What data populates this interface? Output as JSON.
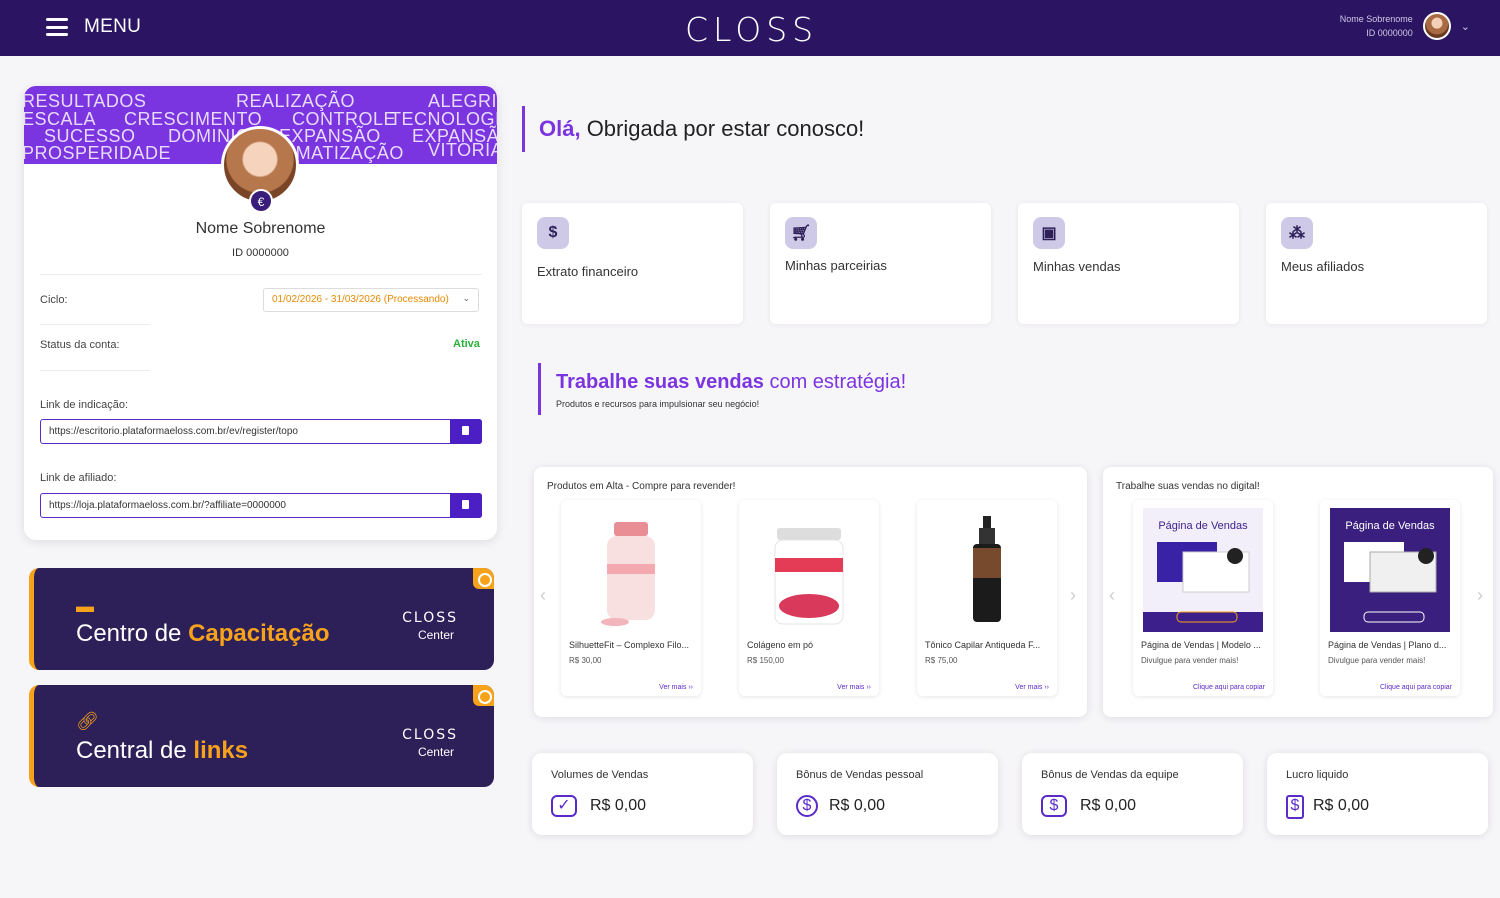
{
  "header": {
    "menu_label": "MENU",
    "logo": "CLOSS",
    "user_name": "Nome Sobrenome",
    "user_id": "ID 0000000"
  },
  "profile": {
    "banner_words": [
      "RESULTADOS",
      "REALIZAÇÃO",
      "ALEGRIA",
      "ESCALA",
      "CRESCIMENTO",
      "CONTROLE",
      "TECNOLOGIA",
      "SUCESSO",
      "DOMINIO",
      "EXPANSÃO",
      "EXPANSÃO",
      "PROSPERIDADE",
      "AUTOMATIZAÇÃO",
      "VITORIA"
    ],
    "name": "Nome Sobrenome",
    "id": "ID 0000000",
    "cycle_label": "Ciclo:",
    "cycle_value": "01/02/2026 - 31/03/2026 (Processando)",
    "status_label": "Status da conta:",
    "status_value": "Ativa",
    "ref_label": "Link de indicação:",
    "ref_link": "https://escritorio.plataformaeloss.com.br/ev/register/topo",
    "aff_label": "Link de afiliado:",
    "aff_link": "https://loja.plataformaeloss.com.br/?affiliate=0000000"
  },
  "promos": [
    {
      "title_a": "Centro de ",
      "title_b": "Capacitação",
      "brand": "CLOSS",
      "sub": "Center"
    },
    {
      "title_a": "Central de ",
      "title_b": "links",
      "brand": "CLOSS",
      "sub": "Center"
    }
  ],
  "greeting": {
    "hello": "Olá,",
    "text": " Obrigada por estar conosco!"
  },
  "quick_links": [
    {
      "label": "Extrato financeiro",
      "icon": "dollar-icon"
    },
    {
      "label": "Minhas parceirias",
      "icon": "cart-icon"
    },
    {
      "label": "Minhas vendas",
      "icon": "wallet-icon"
    },
    {
      "label": "Meus afiliados",
      "icon": "network-icon"
    }
  ],
  "strategy": {
    "bold": "Trabalhe suas vendas",
    "rest": " com estratégia!",
    "sub": "Produtos e recursos para impulsionar seu negócio!"
  },
  "products_panel": {
    "title": "Produtos em Alta - Compre para revender!",
    "items": [
      {
        "name": "SilhuetteFit – Complexo Filo...",
        "price": "R$ 30,00",
        "more": "Ver mais ››"
      },
      {
        "name": "Colágeno em pó",
        "price": "R$ 150,00",
        "more": "Ver mais ››"
      },
      {
        "name": "Tônico Capilar Antiqueda F...",
        "price": "R$ 75,00",
        "more": "Ver mais ››"
      }
    ]
  },
  "digital_panel": {
    "title": "Trabalhe suas vendas no digital!",
    "items": [
      {
        "name": "Página de Vendas | Modelo ...",
        "desc": "Divulgue para vender mais!",
        "link": "Clique aqui para copiar",
        "img_title": "Página de Vendas"
      },
      {
        "name": "Página de Vendas | Plano d...",
        "desc": "Divulgue para vender mais!",
        "link": "Clique aqui para copiar",
        "img_title": "Página de Vendas"
      }
    ]
  },
  "stats": [
    {
      "label": "Volumes de Vendas",
      "value": "R$ 0,00"
    },
    {
      "label": "Bônus de Vendas pessoal",
      "value": "R$ 0,00"
    },
    {
      "label": "Bônus de Vendas da equipe",
      "value": "R$ 0,00"
    },
    {
      "label": "Lucro liquido",
      "value": "R$ 0,00"
    }
  ],
  "colors": {
    "brand_dark": "#2b1563",
    "accent": "#7b35e0",
    "orange": "#f7a21b",
    "success": "#27b03a"
  }
}
